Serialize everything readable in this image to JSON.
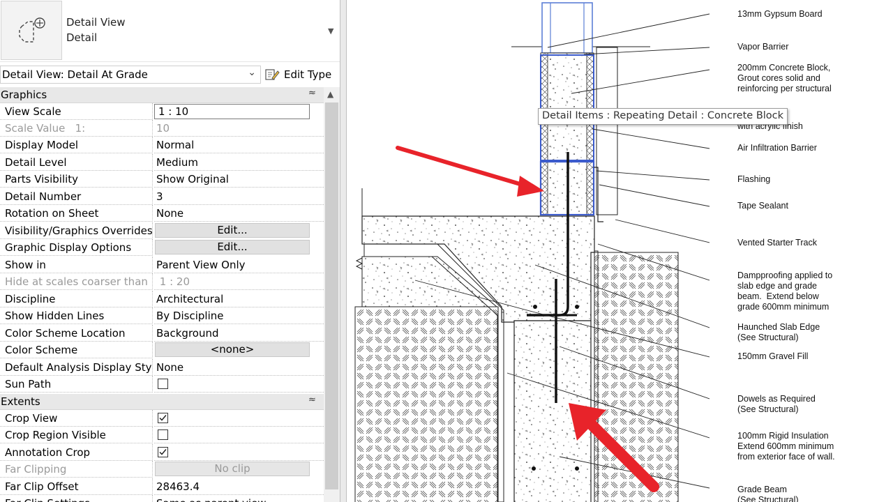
{
  "properties_palette": {
    "type_selector": {
      "line1": "Detail View",
      "line2": "Detail",
      "thumbnail_icon": "detail-view-icon",
      "dropdown_icon": "triangle-down-icon"
    },
    "instance_selector": {
      "value": "Detail View: Detail At Grade",
      "edit_type_label": "Edit Type",
      "edit_type_icon": "edit-type-icon"
    },
    "groups": {
      "graphics": {
        "label": "Graphics",
        "rows": {
          "view_scale": {
            "name": "View Scale",
            "value": "1 : 10"
          },
          "scale_value": {
            "name": "Scale Value",
            "name_suffix": "1:",
            "value": "10"
          },
          "display_model": {
            "name": "Display Model",
            "value": "Normal"
          },
          "detail_level": {
            "name": "Detail Level",
            "value": "Medium"
          },
          "parts_visibility": {
            "name": "Parts Visibility",
            "value": "Show Original"
          },
          "detail_number": {
            "name": "Detail Number",
            "value": "3"
          },
          "rotation_on_sheet": {
            "name": "Rotation on Sheet",
            "value": "None"
          },
          "vg_overrides": {
            "name": "Visibility/Graphics Overrides",
            "value": "Edit..."
          },
          "graphic_display_options": {
            "name": "Graphic Display Options",
            "value": "Edit..."
          },
          "show_in": {
            "name": "Show in",
            "value": "Parent View Only"
          },
          "hide_at_scales": {
            "name": "Hide at scales coarser than",
            "value": "1 : 20"
          },
          "discipline": {
            "name": "Discipline",
            "value": "Architectural"
          },
          "show_hidden_lines": {
            "name": "Show Hidden Lines",
            "value": "By Discipline"
          },
          "color_scheme_location": {
            "name": "Color Scheme Location",
            "value": "Background"
          },
          "color_scheme": {
            "name": "Color Scheme",
            "value": "<none>"
          },
          "default_analysis_display_style": {
            "name": "Default Analysis Display Style",
            "value": "None"
          },
          "sun_path": {
            "name": "Sun Path",
            "checked": false
          }
        }
      },
      "extents": {
        "label": "Extents",
        "rows": {
          "crop_view": {
            "name": "Crop View",
            "checked": true
          },
          "crop_region_visible": {
            "name": "Crop Region Visible",
            "checked": false
          },
          "annotation_crop": {
            "name": "Annotation Crop",
            "checked": true
          },
          "far_clipping": {
            "name": "Far Clipping",
            "value": "No clip"
          },
          "far_clip_offset": {
            "name": "Far Clip Offset",
            "value": "28463.4"
          },
          "far_clip_settings": {
            "name": "Far Clip Settings",
            "value": "Same as parent view"
          }
        }
      }
    }
  },
  "drawing": {
    "tooltip": "Detail Items : Repeating Detail : Concrete Block",
    "annotations": {
      "gypsum": "13mm Gypsum Board",
      "vapor": "Vapor Barrier",
      "block": "200mm Concrete Block,\nGrout cores solid and\nreinforcing per structural",
      "rigid_insulation": "id Insulation\nwith acrylic finish",
      "air_barrier": "Air Infiltration Barrier",
      "flashing": "Flashing",
      "tape": "Tape Sealant",
      "starter_track": "Vented Starter Track",
      "dampproofing": "Dampproofing applied to\nslab edge and grade\nbeam.  Extend below\ngrade 600mm minimum",
      "haunched": "Haunched Slab Edge\n(See Structural)",
      "gravel": "150mm Gravel Fill",
      "dowels": "Dowels as Required\n(See Structural)",
      "rigid_100": "100mm Rigid Insulation\nExtend 600mm minimum\nfrom exterior face of wall.",
      "grade_beam": "Grade Beam\n(See Structural)"
    },
    "highlight_color": "#e8232a",
    "selection_color": "#3b5bcc"
  }
}
